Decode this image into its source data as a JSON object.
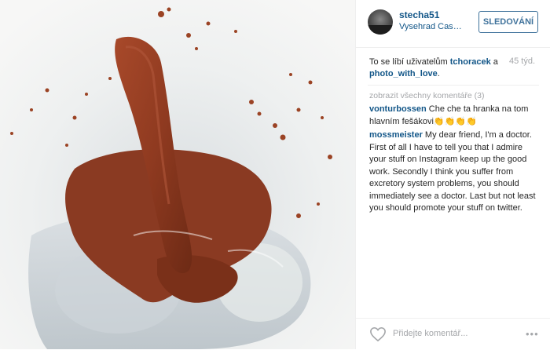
{
  "header": {
    "username": "stecha51",
    "location": "Vysehrad Castl...",
    "follow_label": "SLEDOVÁNÍ"
  },
  "likes": {
    "prefix": "To se líbí uživatelům ",
    "user1": "tchoracek",
    "conj": " a",
    "user2": "photo_with_love",
    "suffix": ".",
    "time": "45 týd."
  },
  "comments": {
    "view_all": "zobrazit všechny komentáře (3)",
    "items": [
      {
        "author": "vonturbossen",
        "text": " Che che ta hranka na tom hlavním fešákovi👏👏👏👏"
      },
      {
        "author": "mossmeister",
        "text": " My dear friend, I'm a doctor. First of all I have to tell you that I admire your stuff on Instagram keep up the good work. Secondly I think you suffer from excretory system problems, you should immediately see a doctor. Last but not least you should promote your stuff on twitter."
      }
    ]
  },
  "footer": {
    "placeholder": "Přidejte komentář...",
    "more": "•••"
  },
  "colors": {
    "link": "#125688",
    "button": "#3f729b",
    "muted": "#a5a7aa",
    "photo_brown": "#8b3a1e"
  },
  "icons": [
    "heart-icon",
    "more-options-icon"
  ]
}
